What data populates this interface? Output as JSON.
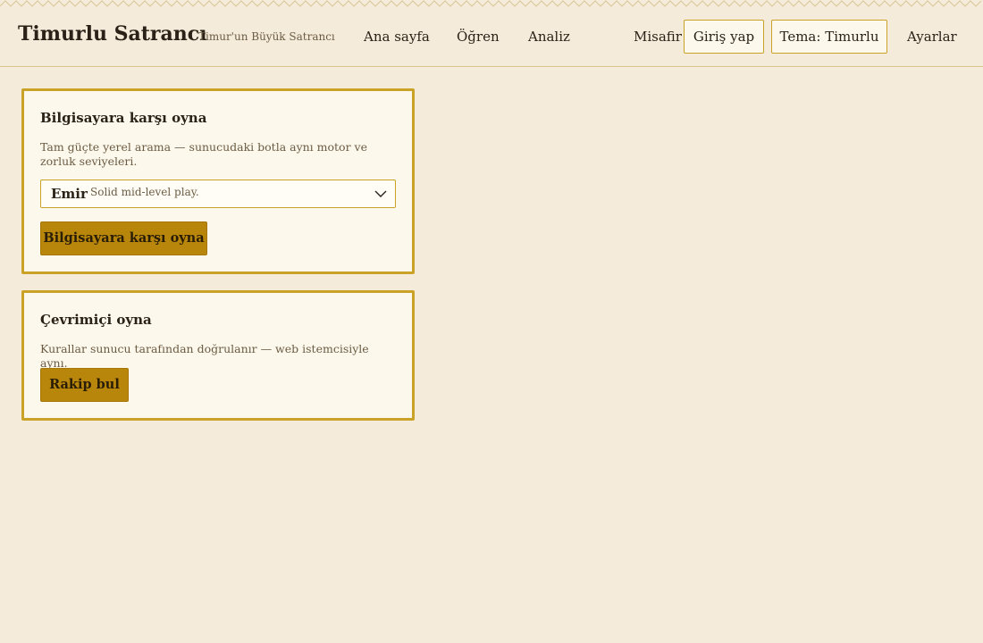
{
  "header": {
    "title": "Timurlu Satrancı",
    "subtitle": "Timur'un Büyük Satrancı",
    "nav": {
      "home": "Ana sayfa",
      "learn": "Öğren",
      "analysis": "Analiz"
    },
    "user": "Misafir",
    "login_label": "Giriş yap",
    "theme_label": "Tema: Timurlu",
    "settings_label": "Ayarlar"
  },
  "vs_computer": {
    "title": "Bilgisayara karşı oyna",
    "description": "Tam güçte yerel arama — sunucudaki botla aynı motor ve zorluk seviyeleri.",
    "level_name": "Emir",
    "level_note": "Solid mid-level play.",
    "button_label": "Bilgisayara karşı oyna"
  },
  "online": {
    "title": "Çevrimiçi oyna",
    "description": "Kurallar sunucu tarafından doğrulanır — web istemcisiyle aynı.",
    "button_label": "Rakip bul"
  },
  "colors": {
    "background": "#f5ebda",
    "card": "#fdf8ec",
    "accent": "#c9a227",
    "primary_button": "#b8860b"
  },
  "icons": {
    "select_arrow": "chevron-down-icon",
    "top_border": "zigzag-border-pattern"
  }
}
